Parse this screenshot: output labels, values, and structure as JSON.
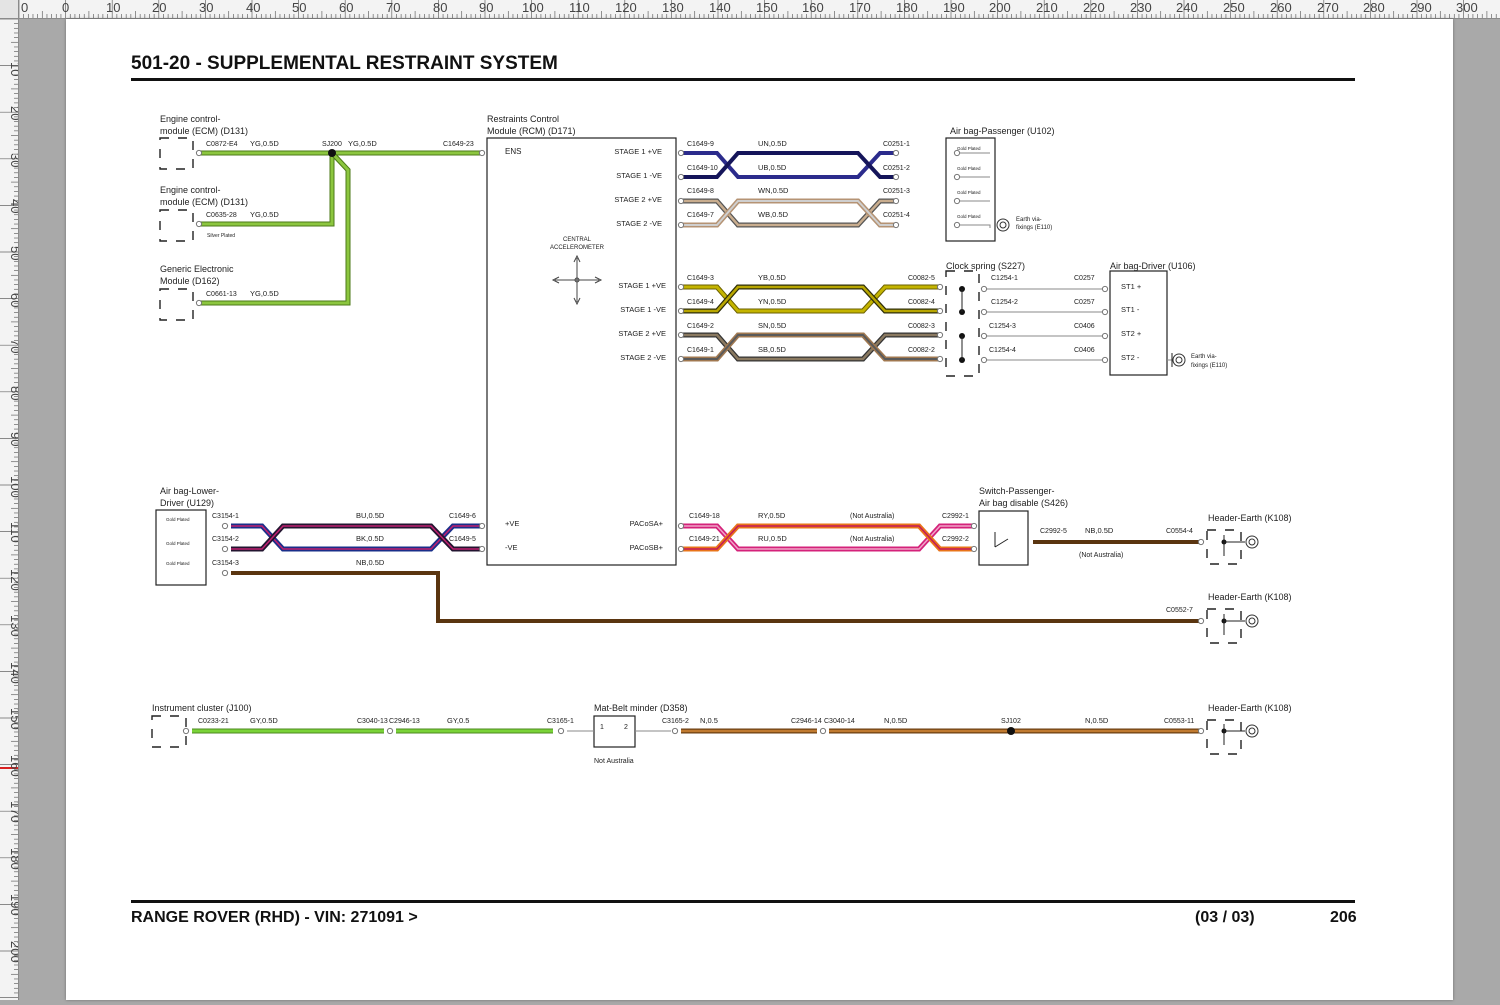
{
  "ruler": {
    "top_ticks": [
      "0",
      "0",
      "10",
      "20",
      "30",
      "40",
      "50",
      "60",
      "70",
      "80",
      "90",
      "100",
      "110",
      "120",
      "130",
      "140",
      "150",
      "160",
      "170",
      "180",
      "190",
      "200",
      "210",
      "220",
      "230",
      "240",
      "250",
      "260",
      "270",
      "280",
      "290",
      "300"
    ],
    "left_ticks": [
      "10",
      "20",
      "30",
      "40",
      "50",
      "60",
      "70",
      "80",
      "90",
      "100",
      "110",
      "120",
      "130",
      "140",
      "150",
      "160",
      "170",
      "180",
      "190",
      "200"
    ]
  },
  "header": {
    "title": "501-20 - SUPPLEMENTAL RESTRAINT SYSTEM"
  },
  "footer": {
    "vehicle": "RANGE ROVER  (RHD) - VIN: 271091 >",
    "sheet": "(03 / 03)",
    "page": "206"
  },
  "colors": {
    "YG": "#8cc63f",
    "GY": "#7ad338",
    "UN": "#2b2b8c",
    "UB": "#15155a",
    "WN": "#b59374",
    "WB": "#9a9a9a",
    "YB": "#a99b00",
    "YN": "#c4b400",
    "SN": "#8a7960",
    "SB": "#555555",
    "BU": "#1a2f8a",
    "BK": "#231530",
    "NB": "#5a3510",
    "RY": "#d4227a",
    "RU": "#e8741a",
    "N": "#9a5a1c"
  },
  "components": {
    "ecm1": {
      "title1": "Engine control-",
      "title2": "module (ECM) (D131)"
    },
    "ecm2": {
      "title1": "Engine control-",
      "title2": "module (ECM) (D131)",
      "note": "Silver Plated"
    },
    "gem": {
      "title1": "Generic Electronic",
      "title2": "Module (D162)"
    },
    "rcm": {
      "title1": "Restraints Control",
      "title2": "Module (RCM) (D171)",
      "ens": "ENS",
      "accel1": "CENTRAL",
      "accel2": "ACCELEROMETER",
      "pins_pass": [
        "STAGE 1 +VE",
        "STAGE 1 -VE",
        "STAGE 2 +VE",
        "STAGE 2 -VE"
      ],
      "pins_drv": [
        "STAGE 1 +VE",
        "STAGE 1 -VE",
        "STAGE 2 +VE",
        "STAGE 2 -VE"
      ],
      "pos": "+VE",
      "neg": "-VE",
      "paca": "PACoSA+",
      "pacb": "PACoSB+"
    },
    "bag_pass": {
      "title": "Air bag-Passenger (U102)",
      "plated": "Gold Plated",
      "earth1": "Earth via-",
      "earth2": "fixings (E110)"
    },
    "clock": {
      "title": "Clock spring (S227)"
    },
    "bag_drv": {
      "title": "Air bag-Driver (U106)",
      "pins": [
        "ST1 +",
        "ST1 -",
        "ST2 +",
        "ST2 -"
      ],
      "earth1": "Earth via-",
      "earth2": "fixings (E110)"
    },
    "bag_low": {
      "title1": "Air bag-Lower-",
      "title2": "Driver (U129)",
      "plated": "Gold Plated"
    },
    "sw": {
      "title1": "Switch-Passenger-",
      "title2": "Air bag disable (S426)"
    },
    "earth1": {
      "title": "Header-Earth (K108)"
    },
    "earth2": {
      "title": "Header-Earth (K108)"
    },
    "earth3": {
      "title": "Header-Earth (K108)"
    },
    "ic": {
      "title": "Instrument cluster (J100)"
    },
    "mbm": {
      "title": "Mat-Belt minder (D358)",
      "p1": "1",
      "p2": "2",
      "note": "Not Australia"
    }
  },
  "splices": {
    "sj200": "SJ200",
    "sj102": "SJ102"
  },
  "connectors": {
    "c0872_e4": "C0872-E4",
    "c0635_28": "C0635-28",
    "c0661_13": "C0661-13",
    "c1649_23": "C1649-23",
    "c1649_9": "C1649-9",
    "c1649_10": "C1649-10",
    "c1649_8": "C1649-8",
    "c1649_7": "C1649-7",
    "c0251_1": "C0251-1",
    "c0251_2": "C0251-2",
    "c0251_3": "C0251-3",
    "c0251_4": "C0251-4",
    "c1649_3": "C1649-3",
    "c1649_4": "C1649-4",
    "c1649_2": "C1649-2",
    "c1649_1": "C1649-1",
    "c0082_5": "C0082-5",
    "c0082_4": "C0082-4",
    "c0082_3": "C0082-3",
    "c0082_2": "C0082-2",
    "c1254_1": "C1254-1",
    "c1254_2": "C1254-2",
    "c1254_3": "C1254-3",
    "c1254_4": "C1254-4",
    "c0257_a": "C0257",
    "c0257_b": "C0257",
    "c0406_a": "C0406",
    "c0406_b": "C0406",
    "c3154_1": "C3154-1",
    "c3154_2": "C3154-2",
    "c3154_3": "C3154-3",
    "c1649_6": "C1649-6",
    "c1649_5": "C1649-5",
    "c1649_18": "C1649-18",
    "c1649_21": "C1649-21",
    "c2992_1": "C2992-1",
    "c2992_2": "C2992-2",
    "c2992_5": "C2992-5",
    "c0554_4": "C0554-4",
    "c0552_7": "C0552-7",
    "c0553_11": "C0553-11",
    "c0233_21": "C0233-21",
    "c3040_13": "C3040-13",
    "c2946_13": "C2946-13",
    "c3165_1": "C3165-1",
    "c3165_2": "C3165-2",
    "c2946_14": "C2946-14",
    "c3040_14": "C3040-14"
  },
  "wires": {
    "yg1": "YG,0.5D",
    "yg2": "YG,0.5D",
    "yg3": "YG,0.5D",
    "yg4": "YG,0.5D",
    "un": "UN,0.5D",
    "ub": "UB,0.5D",
    "wn": "WN,0.5D",
    "wb": "WB,0.5D",
    "yb": "YB,0.5D",
    "yn": "YN,0.5D",
    "sn": "SN,0.5D",
    "sb": "SB,0.5D",
    "bu": "BU,0.5D",
    "bk": "BK,0.5D",
    "nb1": "NB,0.5D",
    "ry": "RY,0.5D",
    "ru": "RU,0.5D",
    "nb2": "NB,0.5D",
    "gy1": "GY,0.5D",
    "gy2": "GY,0.5",
    "n1": "N,0.5",
    "n2": "N,0.5D",
    "n3": "N,0.5D"
  },
  "notes": {
    "not_aus1": "(Not Australia)",
    "not_aus2": "(Not Australia)",
    "not_aus3": "(Not Australia)"
  }
}
